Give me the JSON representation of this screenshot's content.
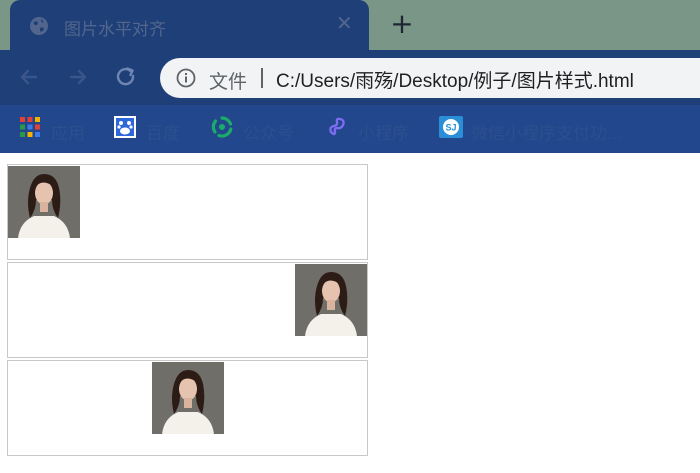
{
  "browser": {
    "tab": {
      "title": "图片水平对齐",
      "close_glyph": "✕",
      "icon": "globe-icon"
    },
    "new_tab_glyph": "+",
    "nav": {
      "back_icon": "arrow-left-icon",
      "forward_icon": "arrow-right-icon",
      "reload_icon": "reload-icon"
    },
    "omnibox": {
      "label": "文件",
      "url": "C:/Users/雨殇/Desktop/例子/图片样式.html"
    },
    "bookmarks": [
      {
        "label": "应用",
        "icon": "apps-grid-icon"
      },
      {
        "label": "百度",
        "icon": "baidu-icon"
      },
      {
        "label": "公众号",
        "icon": "wechat-mp-icon"
      },
      {
        "label": "小程序",
        "icon": "miniprogram-icon"
      },
      {
        "label": "微信小程序支付功...",
        "icon": "sj-icon"
      }
    ]
  },
  "page": {
    "boxes": [
      {
        "align": "left",
        "image": "portrait-photo"
      },
      {
        "align": "right",
        "image": "portrait-photo"
      },
      {
        "align": "center",
        "image": "portrait-photo"
      }
    ]
  },
  "colors": {
    "tab_strip": "#7a9686",
    "toolbar": "#1f3f78",
    "bookmark_bar": "#22478c",
    "omnibox": "#f1f3f4",
    "box_border": "#c8c8c8"
  }
}
